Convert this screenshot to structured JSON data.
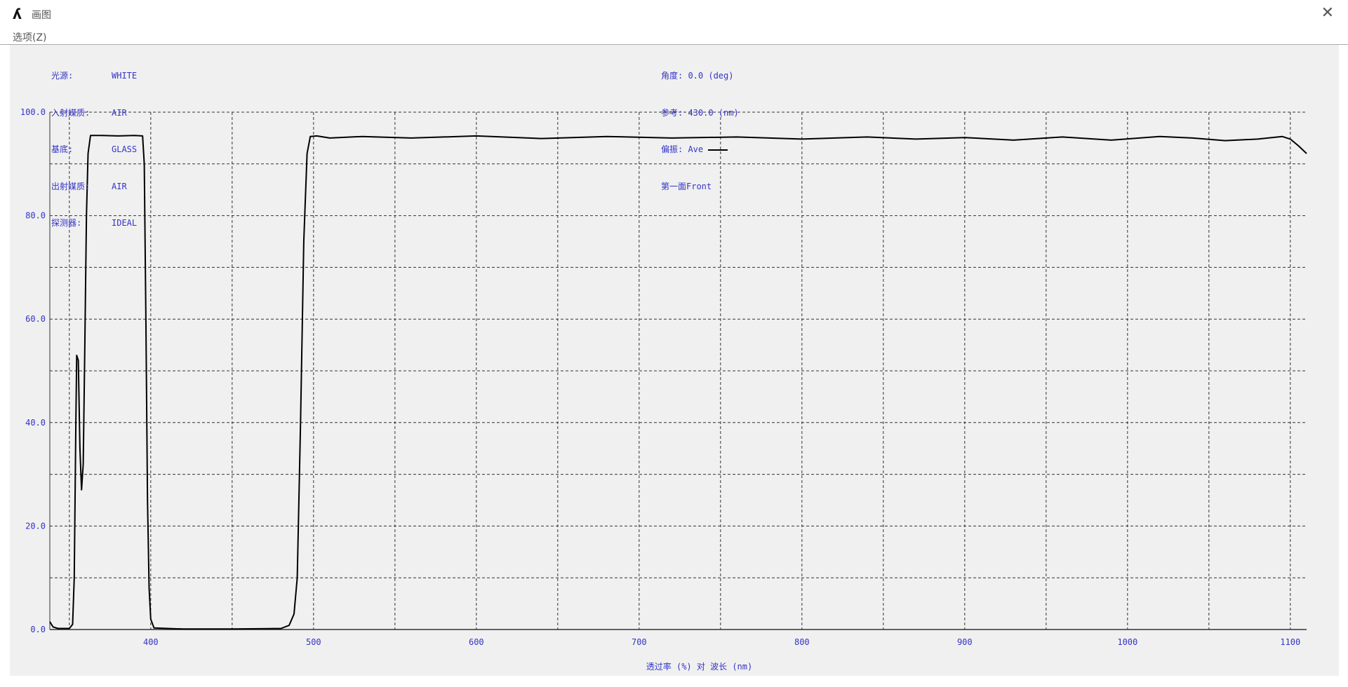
{
  "window": {
    "title": "画图",
    "icon": "app-logo-icon",
    "close_icon": "close-icon"
  },
  "menu": {
    "options": "选项(Z)"
  },
  "info_left": [
    {
      "label": "光源:",
      "value": "WHITE"
    },
    {
      "label": "入射媒质:",
      "value": "AIR"
    },
    {
      "label": "基底:",
      "value": "GLASS"
    },
    {
      "label": "出射媒质:",
      "value": "AIR"
    },
    {
      "label": "探测器:",
      "value": "IDEAL"
    }
  ],
  "info_right": {
    "angle": "角度: 0.0 (deg)",
    "reference": "参考: 430.0 (nm)",
    "polarization": "偏振: Ave",
    "surface": "第一面Front"
  },
  "chart_data": {
    "type": "line",
    "xlabel": "透过率 (%)  对  波长 (nm)",
    "ylabel": "",
    "xlim": [
      338,
      1110
    ],
    "ylim": [
      0,
      100
    ],
    "xticks": [
      400,
      500,
      600,
      700,
      800,
      900,
      1000,
      1100
    ],
    "xgrid": [
      350,
      400,
      450,
      500,
      550,
      600,
      650,
      700,
      750,
      800,
      850,
      900,
      950,
      1000,
      1050,
      1100
    ],
    "yticks": [
      0,
      20,
      40,
      60,
      80,
      100
    ],
    "ygrid_step": 10,
    "ytick_labels": [
      "0.0",
      "20.0",
      "40.0",
      "60.0",
      "80.0",
      "100.0"
    ],
    "grid": true,
    "series": [
      {
        "name": "Ave",
        "color": "#000000",
        "points": [
          [
            338,
            1.5
          ],
          [
            340,
            0.5
          ],
          [
            343,
            0.2
          ],
          [
            350,
            0.2
          ],
          [
            352,
            1
          ],
          [
            353,
            10
          ],
          [
            354,
            40
          ],
          [
            354.5,
            53
          ],
          [
            355.5,
            52
          ],
          [
            356.5,
            35
          ],
          [
            357.5,
            27
          ],
          [
            358.5,
            32
          ],
          [
            359.5,
            55
          ],
          [
            360.5,
            80
          ],
          [
            361.5,
            92
          ],
          [
            363,
            95.5
          ],
          [
            370,
            95.5
          ],
          [
            380,
            95.4
          ],
          [
            390,
            95.5
          ],
          [
            395,
            95.4
          ],
          [
            396,
            90
          ],
          [
            397,
            60
          ],
          [
            398,
            25
          ],
          [
            399,
            8
          ],
          [
            400,
            2
          ],
          [
            402,
            0.3
          ],
          [
            420,
            0.1
          ],
          [
            450,
            0.1
          ],
          [
            480,
            0.2
          ],
          [
            485,
            0.8
          ],
          [
            488,
            3
          ],
          [
            490,
            10
          ],
          [
            492,
            40
          ],
          [
            494,
            75
          ],
          [
            496,
            92
          ],
          [
            498,
            95.3
          ],
          [
            502,
            95.4
          ],
          [
            510,
            95
          ],
          [
            530,
            95.3
          ],
          [
            560,
            95
          ],
          [
            600,
            95.4
          ],
          [
            640,
            94.9
          ],
          [
            680,
            95.3
          ],
          [
            720,
            95
          ],
          [
            760,
            95.2
          ],
          [
            800,
            94.8
          ],
          [
            840,
            95.2
          ],
          [
            870,
            94.8
          ],
          [
            900,
            95.1
          ],
          [
            930,
            94.6
          ],
          [
            960,
            95.2
          ],
          [
            990,
            94.6
          ],
          [
            1020,
            95.3
          ],
          [
            1040,
            95
          ],
          [
            1060,
            94.5
          ],
          [
            1080,
            94.8
          ],
          [
            1095,
            95.3
          ],
          [
            1100,
            94.8
          ],
          [
            1105,
            93.5
          ],
          [
            1110,
            92
          ]
        ]
      }
    ]
  }
}
